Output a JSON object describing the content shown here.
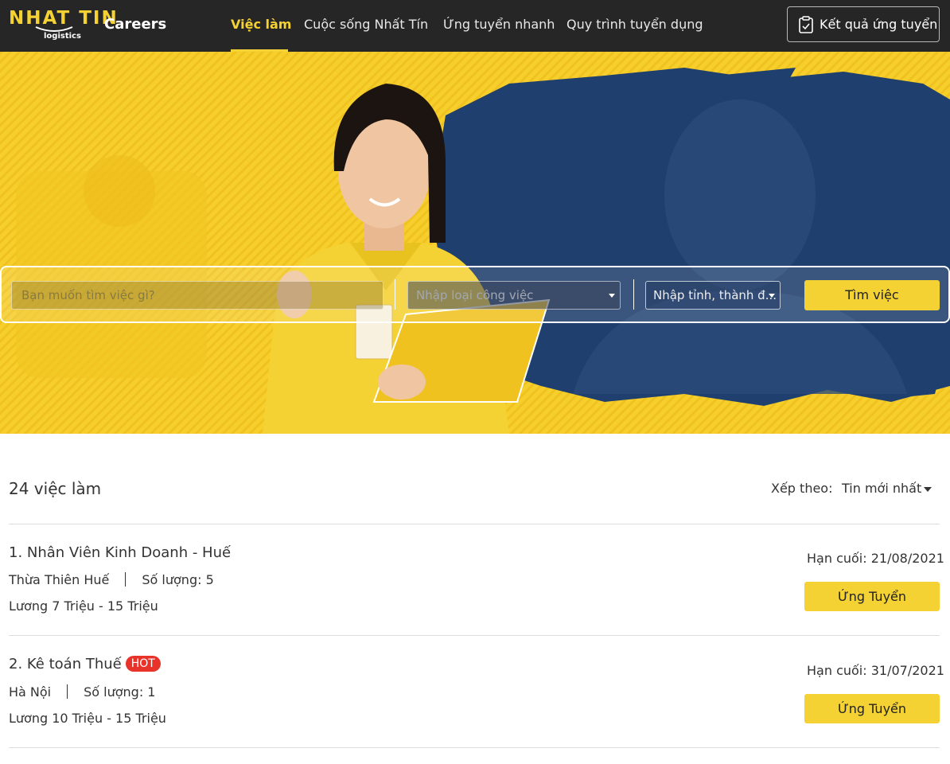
{
  "brand": {
    "logo_text": "NHAT TIN",
    "logo_sub": "logistics",
    "careers_label": "Careers"
  },
  "nav": {
    "items": [
      "Việc làm",
      "Cuộc sống Nhất Tín",
      "Ứng tuyển nhanh",
      "Quy trình tuyển dụng"
    ],
    "active_index": 0,
    "result_button": "Kết quả ứng tuyển"
  },
  "search": {
    "keyword_placeholder": "Bạn muốn tìm việc gì?",
    "type_placeholder": "Nhập loại công việc",
    "location_placeholder": "Nhập tỉnh, thành đ...",
    "button": "Tìm việc"
  },
  "results": {
    "count_label": "24 việc làm",
    "sort_label": "Xếp theo:",
    "sort_value": "Tin mới nhất"
  },
  "jobs": [
    {
      "title": "1. Nhân Viên Kinh Doanh - Huế",
      "hot": "",
      "location": "Thừa Thiên Huế",
      "quantity": "Số lượng: 5",
      "salary": "Lương 7 Triệu - 15 Triệu",
      "deadline": "Hạn cuối:  21/08/2021",
      "apply": "Ứng Tuyển"
    },
    {
      "title": "2. Kê toán Thuế",
      "hot": "HOT",
      "location": "Hà Nội",
      "quantity": "Số lượng: 1",
      "salary": "Lương 10 Triệu - 15 Triệu",
      "deadline": "Hạn cuối:  31/07/2021",
      "apply": "Ứng Tuyển"
    }
  ],
  "colors": {
    "accent": "#f5d233",
    "header_bg": "#262626",
    "hero_blue": "#1f3f6e",
    "hot": "#e8332a"
  }
}
